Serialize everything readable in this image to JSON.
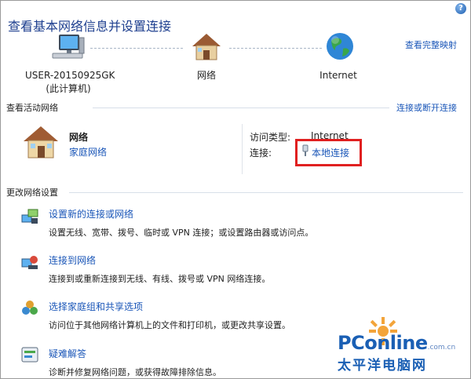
{
  "window": {
    "help_glyph": "?"
  },
  "header": {
    "title": "查看基本网络信息并设置连接",
    "view_full_map": "查看完整映射"
  },
  "map": {
    "computer_name": "USER-20150925GK",
    "computer_sub": "(此计算机)",
    "network_label": "网络",
    "internet_label": "Internet",
    "icons": [
      "computer-icon",
      "house-icon",
      "globe-icon"
    ]
  },
  "active": {
    "heading": "查看活动网络",
    "connect_disconnect": "连接或断开连接",
    "network_name": "网络",
    "network_type": "家庭网络",
    "access_type_label": "访问类型:",
    "access_type_value": "Internet",
    "connections_label": "连接:",
    "connection_link": "本地连接"
  },
  "change": {
    "heading": "更改网络设置",
    "tasks": [
      {
        "icon": "network-setup-icon",
        "title": "设置新的连接或网络",
        "desc": "设置无线、宽带、拨号、临时或 VPN 连接；或设置路由器或访问点。"
      },
      {
        "icon": "connect-network-icon",
        "title": "连接到网络",
        "desc": "连接到或重新连接到无线、有线、拨号或 VPN 网络连接。"
      },
      {
        "icon": "homegroup-icon",
        "title": "选择家庭组和共享选项",
        "desc": "访问位于其他网络计算机上的文件和打印机，或更改共享设置。"
      },
      {
        "icon": "troubleshoot-icon",
        "title": "疑难解答",
        "desc": "诊断并修复网络问题，或获得故障排除信息。"
      }
    ]
  },
  "watermark": {
    "brand": "PConline",
    "domain_suffix": ".com.cn",
    "tagline": "太平洋电脑网"
  },
  "colors": {
    "link": "#1a56b8",
    "title": "#1e3f8f",
    "highlight": "#e02020"
  }
}
